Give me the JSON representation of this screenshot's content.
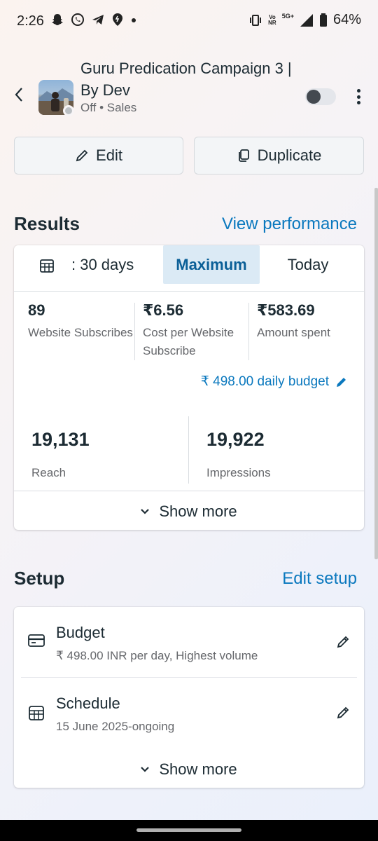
{
  "status_bar": {
    "time": "2:26",
    "network_volte_top": "Vo",
    "network_volte_bottom": "NR",
    "network_type": "5G+",
    "battery": "64%"
  },
  "campaign": {
    "title": "Guru Predication Campaign 3 | By Dev",
    "status": "Off • Sales",
    "toggle_on": false
  },
  "actions": {
    "edit_label": "Edit",
    "duplicate_label": "Duplicate"
  },
  "results": {
    "title": "Results",
    "link": "View performance",
    "tabs": [
      {
        "label": ": 30 days",
        "selected": false
      },
      {
        "label": "Maximum",
        "selected": true
      },
      {
        "label": "Today",
        "selected": false
      }
    ],
    "metrics": [
      {
        "value": "89",
        "label": "Website Subscribes"
      },
      {
        "value": "₹6.56",
        "label": "Cost per Website Subscribe"
      },
      {
        "value": "₹583.69",
        "label": "Amount spent"
      }
    ],
    "budget": "₹ 498.00 daily budget",
    "reach": {
      "value": "19,131",
      "label": "Reach"
    },
    "impressions": {
      "value": "19,922",
      "label": "Impressions"
    },
    "show_more": "Show more"
  },
  "setup": {
    "title": "Setup",
    "link": "Edit setup",
    "budget": {
      "title": "Budget",
      "detail": "₹ 498.00 INR per day, Highest volume"
    },
    "schedule": {
      "title": "Schedule",
      "detail": "15 June 2025-ongoing"
    },
    "show_more": "Show more"
  },
  "colors": {
    "accent": "#0a78be",
    "selected_tab_bg": "#dbeaf5",
    "text_primary": "#1c2b33",
    "text_secondary": "#65676b"
  }
}
